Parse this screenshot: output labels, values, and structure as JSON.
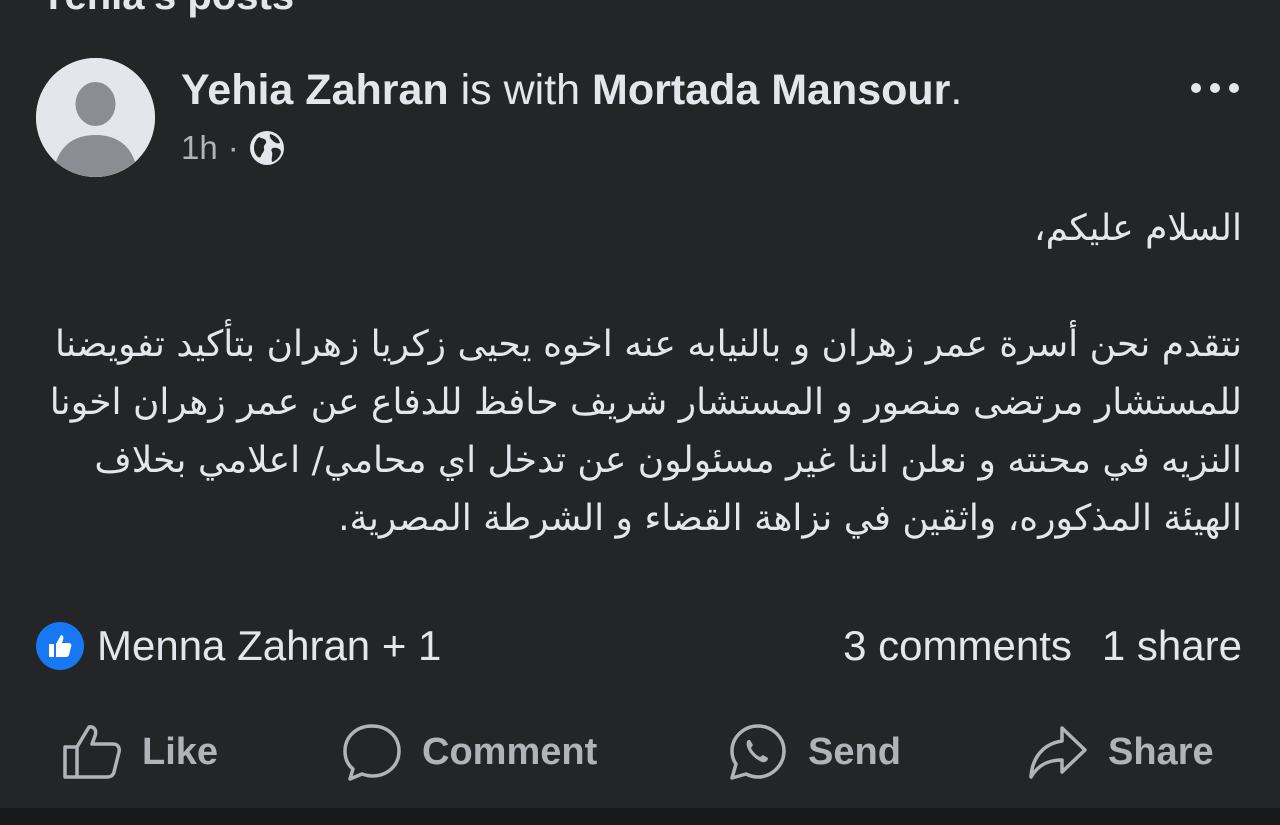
{
  "section": {
    "title": "Yehia's posts"
  },
  "post": {
    "author": "Yehia Zahran",
    "with_text": "is with",
    "tagged": "Mortada Mansour",
    "period": ".",
    "time": "1h",
    "separator": "·",
    "privacy_icon": "globe-icon",
    "more_icon": "more-dots-icon",
    "body": {
      "greeting": "السلام عليكم،",
      "message": "نتقدم نحن أسرة عمر زهران و بالنيابه عنه اخوه يحيى زكريا زهران بتأكيد تفويضنا للمستشار مرتضى منصور و المستشار شريف حافظ للدفاع عن عمر زهران اخونا النزيه في محنته و نعلن اننا غير مسئولون عن تدخل اي محامي/ اعلامي بخلاف الهيئة المذكوره، واثقين في نزاهة القضاء و الشرطة المصرية."
    },
    "reactions": {
      "icon": "like-reaction-icon",
      "text": "Menna Zahran + 1"
    },
    "counts": {
      "comments": "3 comments",
      "shares": "1 share"
    },
    "actions": {
      "like": "Like",
      "comment": "Comment",
      "send": "Send",
      "share": "Share"
    }
  },
  "colors": {
    "background": "#242526",
    "text_primary": "#e4e6eb",
    "text_secondary": "#b0b3b8",
    "like_blue": "#1877f2"
  }
}
